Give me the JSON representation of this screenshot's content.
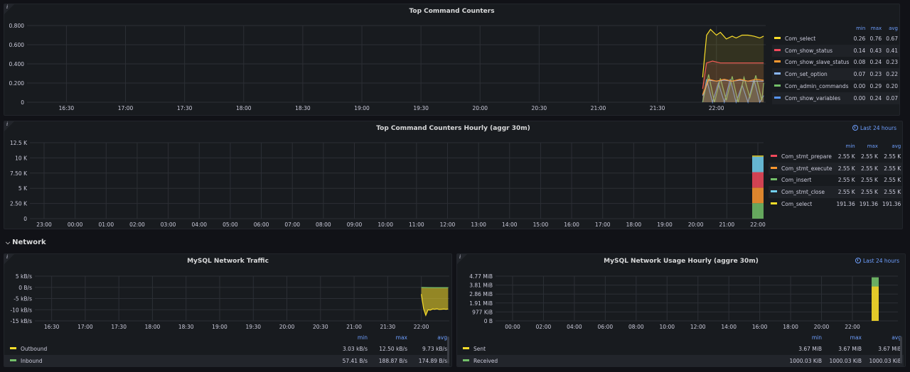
{
  "panels": {
    "top_counters": {
      "title": "Top Command Counters",
      "legend_headers": {
        "min": "min",
        "max": "max",
        "avg": "avg"
      },
      "legend": [
        {
          "name": "Com_select",
          "min": "0.26",
          "max": "0.76",
          "avg": "0.67",
          "color": "#fade2a"
        },
        {
          "name": "Com_show_status",
          "min": "0.14",
          "max": "0.43",
          "avg": "0.41",
          "color": "#f2495c"
        },
        {
          "name": "Com_show_slave_status",
          "min": "0.08",
          "max": "0.24",
          "avg": "0.23",
          "color": "#ff9830"
        },
        {
          "name": "Com_set_option",
          "min": "0.07",
          "max": "0.23",
          "avg": "0.22",
          "color": "#8ab8ff"
        },
        {
          "name": "Com_admin_commands",
          "min": "0.00",
          "max": "0.29",
          "avg": "0.20",
          "color": "#73bf69"
        },
        {
          "name": "Com_show_variables",
          "min": "0.00",
          "max": "0.24",
          "avg": "0.07",
          "color": "#5794f2"
        }
      ]
    },
    "top_counters_hourly": {
      "title": "Top Command Counters Hourly (aggr 30m)",
      "range": "Last 24 hours",
      "legend_headers": {
        "min": "min",
        "max": "max",
        "avg": "avg"
      },
      "legend": [
        {
          "name": "Com_stmt_prepare",
          "min": "2.55 K",
          "max": "2.55 K",
          "avg": "2.55 K",
          "color": "#f2495c"
        },
        {
          "name": "Com_stmt_execute",
          "min": "2.55 K",
          "max": "2.55 K",
          "avg": "2.55 K",
          "color": "#ff9830"
        },
        {
          "name": "Com_insert",
          "min": "2.55 K",
          "max": "2.55 K",
          "avg": "2.55 K",
          "color": "#73bf69"
        },
        {
          "name": "Com_stmt_close",
          "min": "2.55 K",
          "max": "2.55 K",
          "avg": "2.55 K",
          "color": "#73d0f0"
        },
        {
          "name": "Com_select",
          "min": "191.36",
          "max": "191.36",
          "avg": "191.36",
          "color": "#fade2a"
        }
      ]
    },
    "network_row": {
      "title": "Network"
    },
    "net_traffic": {
      "title": "MySQL Network Traffic",
      "legend_headers": {
        "min": "min",
        "max": "max",
        "avg": "avg"
      },
      "legend": [
        {
          "name": "Outbound",
          "min": "3.03 kB/s",
          "max": "12.50 kB/s",
          "avg": "9.73 kB/s",
          "color": "#fade2a"
        },
        {
          "name": "Inbound",
          "min": "57.41 B/s",
          "max": "188.87 B/s",
          "avg": "174.89 B/s",
          "color": "#73bf69"
        }
      ]
    },
    "net_usage_hourly": {
      "title": "MySQL Network Usage Hourly (aggre 30m)",
      "range": "Last 24 hours",
      "legend_headers": {
        "min": "min",
        "max": "max",
        "avg": "avg"
      },
      "legend": [
        {
          "name": "Sent",
          "min": "3.67 MiB",
          "max": "3.67 MiB",
          "avg": "3.67 MiB",
          "color": "#fade2a"
        },
        {
          "name": "Received",
          "min": "1000.03 KiB",
          "max": "1000.03 KiB",
          "avg": "1000.03 KiB",
          "color": "#73bf69"
        }
      ]
    }
  },
  "chart_data": [
    {
      "type": "area",
      "title": "Top Command Counters",
      "x_ticks": [
        "16:30",
        "17:00",
        "17:30",
        "18:00",
        "18:30",
        "19:00",
        "19:30",
        "20:00",
        "20:30",
        "21:00",
        "21:30",
        "22:00"
      ],
      "y_ticks": [
        "0",
        "0.200",
        "0.400",
        "0.600",
        "0.800"
      ],
      "ylim": [
        0,
        0.8
      ],
      "x_range": [
        "16:10",
        "22:25"
      ],
      "series": [
        {
          "name": "Com_select",
          "x": [
            "21:53",
            "21:55",
            "21:57",
            "22:00",
            "22:02",
            "22:05",
            "22:08",
            "22:10",
            "22:13",
            "22:16",
            "22:19",
            "22:22",
            "22:24"
          ],
          "values": [
            0.26,
            0.7,
            0.76,
            0.7,
            0.73,
            0.66,
            0.69,
            0.67,
            0.7,
            0.7,
            0.69,
            0.67,
            0.69
          ]
        },
        {
          "name": "Com_show_status",
          "x": [
            "21:53",
            "21:55",
            "21:58",
            "22:02",
            "22:06",
            "22:10",
            "22:14",
            "22:18",
            "22:22",
            "22:24"
          ],
          "values": [
            0.14,
            0.41,
            0.43,
            0.41,
            0.41,
            0.41,
            0.41,
            0.41,
            0.41,
            0.41
          ]
        },
        {
          "name": "Com_show_slave_status",
          "x": [
            "21:53",
            "21:56",
            "22:00",
            "22:04",
            "22:08",
            "22:12",
            "22:16",
            "22:20",
            "22:24"
          ],
          "values": [
            0.08,
            0.24,
            0.22,
            0.24,
            0.22,
            0.24,
            0.22,
            0.24,
            0.23
          ]
        },
        {
          "name": "Com_set_option",
          "x": [
            "21:53",
            "21:56",
            "22:00",
            "22:04",
            "22:08",
            "22:12",
            "22:16",
            "22:20",
            "22:24"
          ],
          "values": [
            0.07,
            0.23,
            0.22,
            0.23,
            0.22,
            0.23,
            0.22,
            0.22,
            0.22
          ]
        },
        {
          "name": "Com_admin_commands",
          "x": [
            "21:53",
            "21:56",
            "21:59",
            "22:02",
            "22:05",
            "22:08",
            "22:11",
            "22:14",
            "22:17",
            "22:20",
            "22:23",
            "22:24"
          ],
          "values": [
            0.0,
            0.29,
            0.0,
            0.25,
            0.02,
            0.27,
            0.0,
            0.26,
            0.05,
            0.28,
            0.02,
            0.2
          ]
        },
        {
          "name": "Com_show_variables",
          "x": [
            "21:53",
            "21:55",
            "21:58",
            "22:01",
            "22:04",
            "22:07",
            "22:10",
            "22:13",
            "22:16",
            "22:19",
            "22:22",
            "22:24"
          ],
          "values": [
            0.0,
            0.24,
            0.0,
            0.2,
            0.0,
            0.24,
            0.0,
            0.18,
            0.0,
            0.24,
            0.0,
            0.07
          ]
        }
      ]
    },
    {
      "type": "bar",
      "title": "Top Command Counters Hourly (aggr 30m)",
      "x_ticks": [
        "23:00",
        "00:00",
        "01:00",
        "02:00",
        "03:00",
        "04:00",
        "05:00",
        "06:00",
        "07:00",
        "08:00",
        "09:00",
        "10:00",
        "11:00",
        "12:00",
        "13:00",
        "14:00",
        "15:00",
        "16:00",
        "17:00",
        "18:00",
        "19:00",
        "20:00",
        "21:00",
        "22:00"
      ],
      "y_ticks": [
        "0",
        "2.50 K",
        "5 K",
        "7.50 K",
        "10 K",
        "12.5 K"
      ],
      "ylim": [
        0,
        12500
      ],
      "categories": [
        "22:00"
      ],
      "stacked": true,
      "series": [
        {
          "name": "Com_insert",
          "values": [
            2550
          ]
        },
        {
          "name": "Com_stmt_execute",
          "values": [
            2550
          ]
        },
        {
          "name": "Com_stmt_prepare",
          "values": [
            2550
          ]
        },
        {
          "name": "Com_stmt_close",
          "values": [
            2550
          ]
        },
        {
          "name": "Com_select",
          "values": [
            191.36
          ]
        }
      ]
    },
    {
      "type": "area",
      "title": "MySQL Network Traffic",
      "x_ticks": [
        "16:30",
        "17:00",
        "17:30",
        "18:00",
        "18:30",
        "19:00",
        "19:30",
        "20:00",
        "20:30",
        "21:00",
        "21:30",
        "22:00"
      ],
      "y_ticks": [
        "-15 kB/s",
        "-10 kB/s",
        "-5 kB/s",
        "0 B/s",
        "5 kB/s"
      ],
      "ylim": [
        -15,
        5
      ],
      "y_unit": "kB/s",
      "x_range": [
        "16:15",
        "22:25"
      ],
      "series": [
        {
          "name": "Outbound",
          "x": [
            "22:00",
            "22:02",
            "22:04",
            "22:06",
            "22:08",
            "22:10",
            "22:12",
            "22:14",
            "22:16",
            "22:18",
            "22:20",
            "22:22",
            "22:24"
          ],
          "values": [
            -3.03,
            -9.5,
            -12.5,
            -10,
            -10.2,
            -9.7,
            -9.8,
            -9.6,
            -9.9,
            -9.8,
            -9.7,
            -9.8,
            -9.7
          ]
        },
        {
          "name": "Inbound",
          "x": [
            "22:00",
            "22:12",
            "22:24"
          ],
          "values": [
            -0.06,
            -0.19,
            -0.17
          ]
        }
      ]
    },
    {
      "type": "bar",
      "title": "MySQL Network Usage Hourly (aggre 30m)",
      "x_ticks": [
        "00:00",
        "02:00",
        "04:00",
        "06:00",
        "08:00",
        "10:00",
        "12:00",
        "14:00",
        "16:00",
        "18:00",
        "20:00",
        "22:00"
      ],
      "y_ticks": [
        "0 B",
        "977 KiB",
        "1.91 MiB",
        "2.86 MiB",
        "3.81 MiB",
        "4.77 MiB"
      ],
      "ylim": [
        0,
        4.77
      ],
      "y_unit": "MiB",
      "categories": [
        "22:00"
      ],
      "stacked": true,
      "series": [
        {
          "name": "Sent",
          "values": [
            3.67
          ]
        },
        {
          "name": "Received",
          "values": [
            0.977
          ]
        }
      ]
    }
  ]
}
